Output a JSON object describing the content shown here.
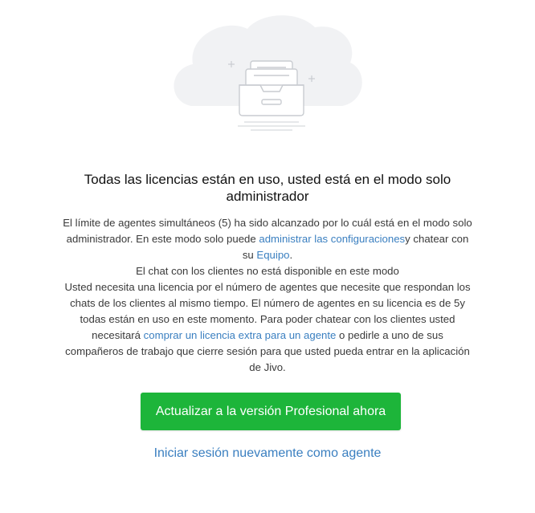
{
  "colors": {
    "primary_button": "#1db53a",
    "link": "#3a7fc0",
    "illustration_cloud": "#f1f2f4",
    "illustration_lines": "#c9ccd1"
  },
  "illustration": {
    "icon": "inbox-tray-icon"
  },
  "title": "Todas las licencias están en uso, usted está en el modo solo administrador",
  "message": {
    "p1_before": "El límite de agentes simultáneos (5) ha sido alcanzado por lo cuál está en el modo solo administrador. En este modo solo puede ",
    "p1_link": "administrar las configuraciones",
    "p1_middle": "y chatear con su ",
    "p1_link2": "Equipo",
    "p1_after": ".",
    "p2": "El chat con los clientes no está disponible en este modo",
    "p3_before": "Usted necesita una licencia por el número de agentes que necesite que respondan los chats de los clientes al mismo tiempo. El número de agentes en su licencia es de 5y todas están en uso en este momento. Para poder chatear con los clientes usted necesitará ",
    "p3_link": "comprar un licencia extra para un agente",
    "p3_after": " o pedirle a uno de sus compañeros de trabajo que cierre sesión para que usted pueda entrar en la aplicación de Jivo."
  },
  "buttons": {
    "upgrade": "Actualizar a la versión Profesional ahora",
    "login_agent": "Iniciar sesión nuevamente como agente"
  }
}
